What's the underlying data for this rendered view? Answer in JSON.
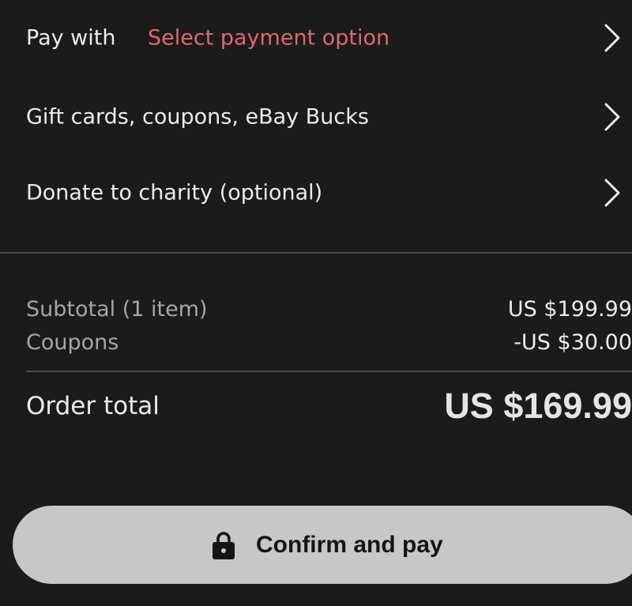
{
  "rows": [
    {
      "label": "Pay with",
      "value": "Select payment option"
    },
    {
      "label": "Gift cards, coupons, eBay Bucks"
    },
    {
      "label": "Donate to charity (optional)"
    }
  ],
  "summary": {
    "subtotal_label": "Subtotal (1 item)",
    "subtotal_value": "US $199.99",
    "coupons_label": "Coupons",
    "coupons_value": "-US $30.00",
    "total_label": "Order total",
    "total_value": "US $169.99"
  },
  "confirm": {
    "label": "Confirm and pay"
  },
  "icons": {
    "chevron": "chevron-right-icon",
    "lock": "lock-icon"
  },
  "colors": {
    "background": "#1b1b1b",
    "accent_red": "#e0676f",
    "button_bg": "#c7c7c7"
  }
}
